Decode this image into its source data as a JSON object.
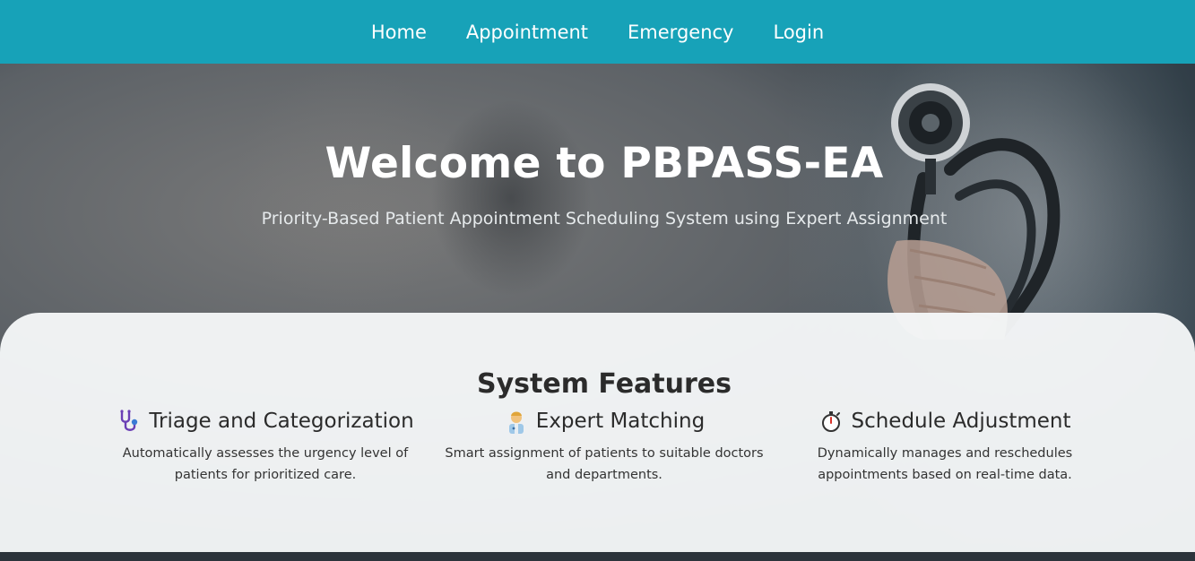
{
  "nav": {
    "items": [
      "Home",
      "Appointment",
      "Emergency",
      "Login"
    ]
  },
  "hero": {
    "title": "Welcome to PBPASS-EA",
    "subtitle": "Priority-Based Patient Appointment Scheduling System using Expert Assignment"
  },
  "features": {
    "heading": "System Features",
    "items": [
      {
        "icon": "stethoscope-icon",
        "title": "Triage and Categorization",
        "desc_line1": "Automatically assesses the urgency level of",
        "desc_line2": "patients for prioritized care."
      },
      {
        "icon": "doctor-icon",
        "title": "Expert Matching",
        "desc_line1": "Smart assignment of patients to suitable doctors",
        "desc_line2": "and departments."
      },
      {
        "icon": "stopwatch-icon",
        "title": "Schedule Adjustment",
        "desc_line1": "Dynamically manages and reschedules",
        "desc_line2": "appointments based on real-time data."
      }
    ]
  },
  "colors": {
    "navbar": "#17a2b8",
    "panel": "#f5f7f8",
    "text": "#2b2b2b"
  }
}
